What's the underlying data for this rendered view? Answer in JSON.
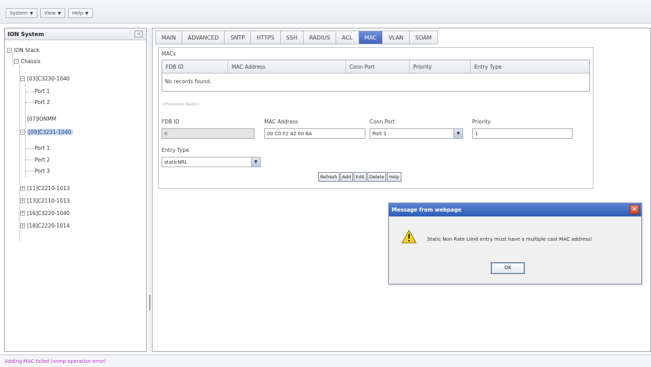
{
  "menubar": {
    "items": [
      "System",
      "View",
      "Help"
    ]
  },
  "tree": {
    "title": "ION System",
    "nodes": [
      {
        "label": "ION Stack"
      },
      {
        "label": "Chassis"
      },
      {
        "label": "[03]C3230-1040"
      },
      {
        "label": "Port 1"
      },
      {
        "label": "Port 2"
      },
      {
        "label": "[07]IONMM"
      },
      {
        "label": "[09]C3231-1040"
      },
      {
        "label": "Port 1"
      },
      {
        "label": "Port 2"
      },
      {
        "label": "Port 3"
      },
      {
        "label": "[11]C2210-1013"
      },
      {
        "label": "[13]C2110-1013"
      },
      {
        "label": "[16]C3220-1040"
      },
      {
        "label": "[18]C2220-1014"
      }
    ]
  },
  "tabs": [
    "MAIN",
    "ADVANCED",
    "SNTP",
    "HTTPS",
    "SSH",
    "RADIUS",
    "ACL",
    "MAC",
    "VLAN",
    "SOAM"
  ],
  "active_tab": "MAC",
  "macs": {
    "legend": "MACs",
    "columns": [
      "FDB ID",
      "MAC Address",
      "Conn Port",
      "Priority",
      "Entry Type"
    ],
    "empty_text": "No records found.",
    "pager": "<Previous  Next>"
  },
  "form": {
    "fdb_label": "FDB ID",
    "fdb_value": "0",
    "mac_label": "MAC Address",
    "mac_value": "00 C0 F2 42 00 8A",
    "conn_label": "Conn Port",
    "conn_value": "Port 1",
    "priority_label": "Priority",
    "priority_value": "1",
    "entry_label": "Entry Type",
    "entry_value": "staticNRL"
  },
  "buttons": {
    "refresh": "Refresh",
    "add": "Add",
    "edit": "Edit",
    "delete": "Delete",
    "help": "Help"
  },
  "dialog": {
    "title": "Message from webpage",
    "message": "Static Non Rate Limit entry must have a multiple cast MAC address!",
    "ok": "OK"
  },
  "status": {
    "text": "Adding MAC failed (snmp operation error)",
    "color": "#c03ad1"
  },
  "colors": {
    "active_tab": "#4a6cc8",
    "dialog_title": "#3a66c0",
    "selected_node": "#c5d7f2"
  }
}
